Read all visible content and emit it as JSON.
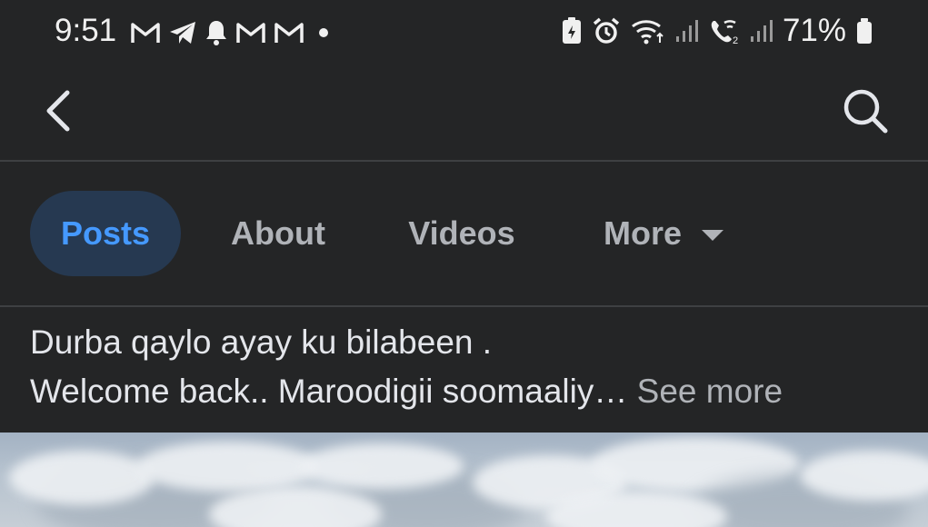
{
  "status_bar": {
    "time": "9:51",
    "notification_icons": [
      "gmail-icon",
      "telegram-icon",
      "bell-icon",
      "gmail-icon",
      "gmail-icon",
      "dot-icon"
    ],
    "system_icons": [
      "battery-saver-icon",
      "alarm-icon",
      "wifi-icon",
      "signal-icon",
      "wifi-call-icon",
      "signal-icon"
    ],
    "battery": "71%"
  },
  "top_bar": {
    "back_icon": "chevron-left-icon",
    "search_icon": "search-icon"
  },
  "tabs": [
    {
      "label": "Posts",
      "active": true
    },
    {
      "label": "About",
      "active": false
    },
    {
      "label": "Videos",
      "active": false
    },
    {
      "label": "More",
      "active": false
    }
  ],
  "post": {
    "line1": "Durba qaylo ayay ku bilabeen .",
    "line2": "Welcome back.. Maroodigii soomaaliy…",
    "see_more": "See more"
  },
  "colors": {
    "background": "#242526",
    "active_tab_bg": "#263951",
    "active_tab_text": "#4599ff",
    "inactive_tab_text": "#b0b3b8"
  }
}
